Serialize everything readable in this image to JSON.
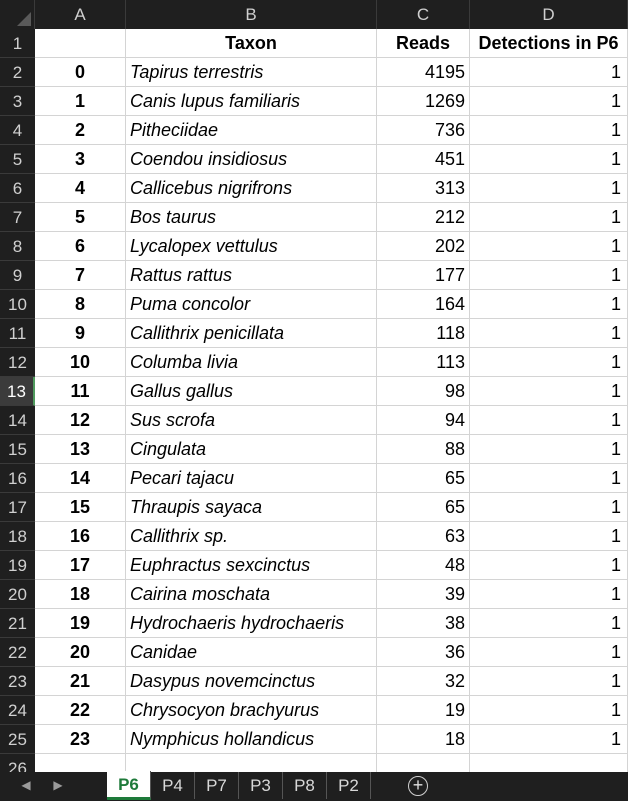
{
  "columns": [
    "A",
    "B",
    "C",
    "D"
  ],
  "header_row": {
    "row": "1",
    "a": "",
    "b": "Taxon",
    "c": "Reads",
    "d": "Detections in P6"
  },
  "rows": [
    {
      "row": "2",
      "a": "0",
      "b": "Tapirus terrestris",
      "c": "4195",
      "d": "1"
    },
    {
      "row": "3",
      "a": "1",
      "b": "Canis lupus familiaris",
      "c": "1269",
      "d": "1"
    },
    {
      "row": "4",
      "a": "2",
      "b": "Pitheciidae",
      "c": "736",
      "d": "1"
    },
    {
      "row": "5",
      "a": "3",
      "b": "Coendou insidiosus",
      "c": "451",
      "d": "1"
    },
    {
      "row": "6",
      "a": "4",
      "b": "Callicebus nigrifrons",
      "c": "313",
      "d": "1"
    },
    {
      "row": "7",
      "a": "5",
      "b": "Bos taurus",
      "c": "212",
      "d": "1"
    },
    {
      "row": "8",
      "a": "6",
      "b": "Lycalopex vettulus",
      "c": "202",
      "d": "1"
    },
    {
      "row": "9",
      "a": "7",
      "b": "Rattus rattus",
      "c": "177",
      "d": "1"
    },
    {
      "row": "10",
      "a": "8",
      "b": "Puma concolor",
      "c": "164",
      "d": "1"
    },
    {
      "row": "11",
      "a": "9",
      "b": "Callithrix penicillata",
      "c": "118",
      "d": "1"
    },
    {
      "row": "12",
      "a": "10",
      "b": "Columba livia",
      "c": "113",
      "d": "1"
    },
    {
      "row": "13",
      "a": "11",
      "b": "Gallus gallus",
      "c": "98",
      "d": "1"
    },
    {
      "row": "14",
      "a": "12",
      "b": "Sus scrofa",
      "c": "94",
      "d": "1"
    },
    {
      "row": "15",
      "a": "13",
      "b": "Cingulata",
      "c": "88",
      "d": "1"
    },
    {
      "row": "16",
      "a": "14",
      "b": "Pecari tajacu",
      "c": "65",
      "d": "1"
    },
    {
      "row": "17",
      "a": "15",
      "b": "Thraupis sayaca",
      "c": "65",
      "d": "1"
    },
    {
      "row": "18",
      "a": "16",
      "b": "Callithrix sp.",
      "c": "63",
      "d": "1"
    },
    {
      "row": "19",
      "a": "17",
      "b": "Euphractus sexcinctus",
      "c": "48",
      "d": "1"
    },
    {
      "row": "20",
      "a": "18",
      "b": "Cairina moschata",
      "c": "39",
      "d": "1"
    },
    {
      "row": "21",
      "a": "19",
      "b": "Hydrochaeris hydrochaeris",
      "c": "38",
      "d": "1"
    },
    {
      "row": "22",
      "a": "20",
      "b": "Canidae",
      "c": "36",
      "d": "1"
    },
    {
      "row": "23",
      "a": "21",
      "b": "Dasypus novemcinctus",
      "c": "32",
      "d": "1"
    },
    {
      "row": "24",
      "a": "22",
      "b": "Chrysocyon brachyurus",
      "c": "19",
      "d": "1"
    },
    {
      "row": "25",
      "a": "23",
      "b": "Nymphicus hollandicus",
      "c": "18",
      "d": "1"
    }
  ],
  "partial_row": "26",
  "selected_row": "13",
  "sheet_tabs": [
    "P6",
    "P4",
    "P7",
    "P3",
    "P8",
    "P2"
  ],
  "active_tab": "P6",
  "nav_icons": [
    "chevron-left-icon",
    "chevron-right-icon"
  ],
  "add_sheet_icon": "plus-circle-icon",
  "colors": {
    "accent": "#1e7a3a",
    "grid": "#d4d4d4",
    "chrome": "#1f1f1f"
  }
}
